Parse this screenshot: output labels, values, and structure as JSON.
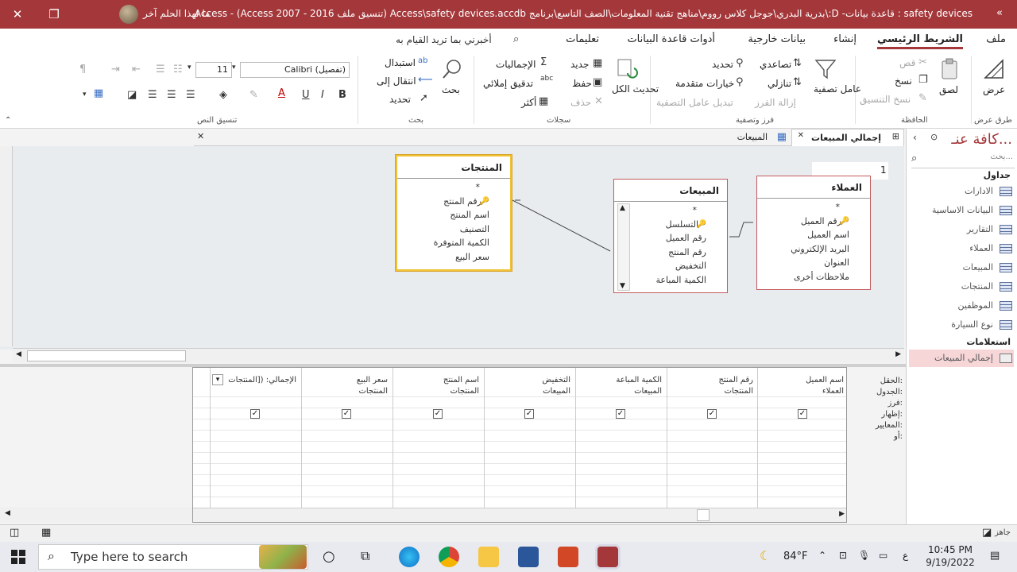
{
  "titlebar": {
    "title": "safety devices : قاعدة بيانات- D:\\بدرية البدري\\جوجل كلاس رووم\\مناهج تقنية المعلومات\\الصف التاسع\\برنامج Access\\safety devices.accdb (تنسيق ملف Access 2007 - 2016) - Access",
    "account": "ما لهذا الحلم آخر",
    "close": "✕",
    "restore": "❐",
    "more": "«"
  },
  "tabs": [
    "ملف",
    "الشريط الرئيسي",
    "إنشاء",
    "بيانات خارجية",
    "أدوات قاعدة البيانات",
    "تعليمات"
  ],
  "active_tab": "الشريط الرئيسي",
  "tellme": "أخبرني بما تريد القيام به",
  "ribbon": {
    "views": {
      "label": "عرض",
      "group": "طرق عرض"
    },
    "clipboard": {
      "paste": "لصق",
      "cut": "قص",
      "copy": "نسخ",
      "format_painter": "نسخ التنسيق",
      "group": "الحافظة"
    },
    "sort_filter": {
      "filter": "عامل تصفية",
      "ascending": "تصاعدي",
      "descending": "تنازلي",
      "remove_sort": "إزالة الفرز",
      "selection": "تحديد",
      "advanced": "خيارات متقدمة",
      "toggle_filter": "تبديل عامل التصفية",
      "group": "فرز وتصفية"
    },
    "records": {
      "refresh_all": "تحديث الكل",
      "new": "جديد",
      "save": "حفظ",
      "delete": "حذف",
      "totals": "الإجماليات",
      "spelling": "تدقيق إملائي",
      "more": "أكثر",
      "group": "سجلات"
    },
    "find": {
      "find": "بحث",
      "replace": "استبدال",
      "goto": "انتقال إلى",
      "select": "تحديد",
      "group": "بحث"
    },
    "text_format": {
      "font": "Calibri (تفصيل)",
      "size": "11",
      "group": "تنسيق النص"
    }
  },
  "nav": {
    "title": "كافة عنـ...",
    "search_placeholder": "بحث...",
    "sections": [
      {
        "label": "جداول",
        "items": [
          "الادارات",
          "البيانات الاساسية",
          "التقارير",
          "العملاء",
          "المبيعات",
          "المنتجات",
          "الموظفين",
          "نوع السيارة"
        ]
      },
      {
        "label": "استعلامات",
        "items": [
          "إجمالي المبيعات"
        ]
      }
    ]
  },
  "doctabs": [
    {
      "label": "إجمالي المبيعات",
      "active": true
    },
    {
      "label": "المبيعات",
      "active": false
    }
  ],
  "design": {
    "relationship_label": "1",
    "tables": [
      {
        "name": "المنتجات",
        "fields": [
          "*",
          "رقم المنتج",
          "اسم المنتج",
          "التصنيف",
          "الكمية المتوفرة",
          "سعر البيع"
        ]
      },
      {
        "name": "المبيعات",
        "fields": [
          "*",
          "التسلسل",
          "رقم العميل",
          "رقم المنتج",
          "التخفيض",
          "الكمية المباعة"
        ]
      },
      {
        "name": "العملاء",
        "fields": [
          "*",
          "رقم العميل",
          "اسم العميل",
          "البريد الإلكتروني",
          "العنوان",
          "ملاحظات أخرى"
        ]
      }
    ]
  },
  "grid": {
    "row_labels": [
      "الحقل:",
      "الجدول:",
      "فرز:",
      "إظهار:",
      "المعايير:",
      "أو:"
    ],
    "columns": [
      {
        "field": "اسم العميل",
        "table": "العملاء"
      },
      {
        "field": "رقم المنتج",
        "table": "المنتجات"
      },
      {
        "field": "الكمية المباعة",
        "table": "المبيعات"
      },
      {
        "field": "التخفيض",
        "table": "المبيعات"
      },
      {
        "field": "اسم المنتج",
        "table": "المنتجات"
      },
      {
        "field": "سعر البيع",
        "table": "المنتجات"
      },
      {
        "field": "الإجمالي: ([المنتجات",
        "table": ""
      }
    ],
    "check": "✓"
  },
  "status": {
    "text": "جاهز"
  },
  "taskbar": {
    "search_placeholder": "Type here to search",
    "weather": "84°F",
    "time": "10:45 PM",
    "date": "9/19/2022",
    "lang": "ع"
  }
}
